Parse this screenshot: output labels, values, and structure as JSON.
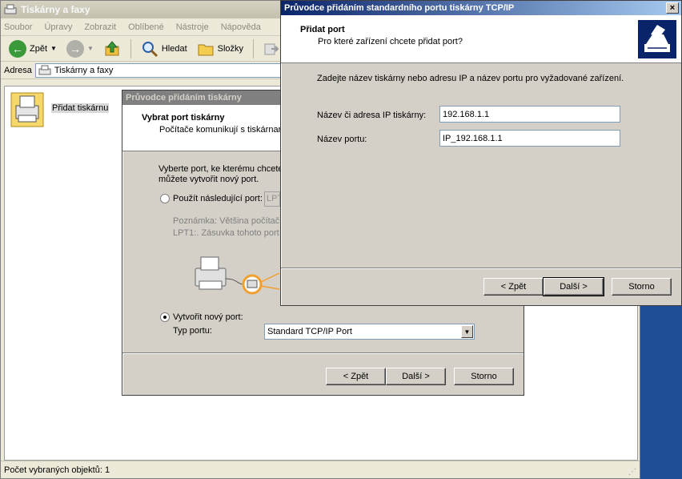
{
  "explorer": {
    "title": "Tiskárny a faxy",
    "menu": [
      "Soubor",
      "Úpravy",
      "Zobrazit",
      "Oblíbené",
      "Nástroje",
      "Nápověda"
    ],
    "toolbar": {
      "back": "Zpět",
      "search": "Hledat",
      "folders": "Složky"
    },
    "address_label": "Adresa",
    "address_value": "Tiskárny a faxy",
    "item_label": "Přidat tiskárnu",
    "status": "Počet vybraných objektů: 1"
  },
  "wizard1": {
    "title": "Průvodce přidáním tiskárny",
    "header_title": "Vybrat port tiskárny",
    "header_subtitle": "Počítače komunikují s tiskárnar",
    "intro_line1": "Vyberte port, ke kterému chcete",
    "intro_line2": "můžete vytvořit nový port.",
    "radio_use": "Použít následující port:",
    "use_port_value": "LPT",
    "note_line1": "Poznámka: Většina počítač",
    "note_line2": "LPT1:. Zásuvka tohoto port",
    "radio_create": "Vytvořit nový port:",
    "port_type_label": "Typ portu:",
    "port_type_value": "Standard TCP/IP Port",
    "btn_back": "< Zpět",
    "btn_next": "Další >",
    "btn_cancel": "Storno"
  },
  "wizard2": {
    "title": "Průvodce přidáním standardního portu tiskárny TCP/IP",
    "header_title": "Přidat port",
    "header_subtitle": "Pro které zařízení chcete přidat port?",
    "instruction": "Zadejte název tiskárny nebo adresu IP a název portu pro vyžadované zařízení.",
    "label_ip": "Název či adresa IP tiskárny:",
    "value_ip": "192.168.1.1",
    "label_port": "Název portu:",
    "value_port": "IP_192.168.1.1",
    "btn_back": "< Zpět",
    "btn_next": "Další >",
    "btn_cancel": "Storno",
    "close": "×"
  }
}
